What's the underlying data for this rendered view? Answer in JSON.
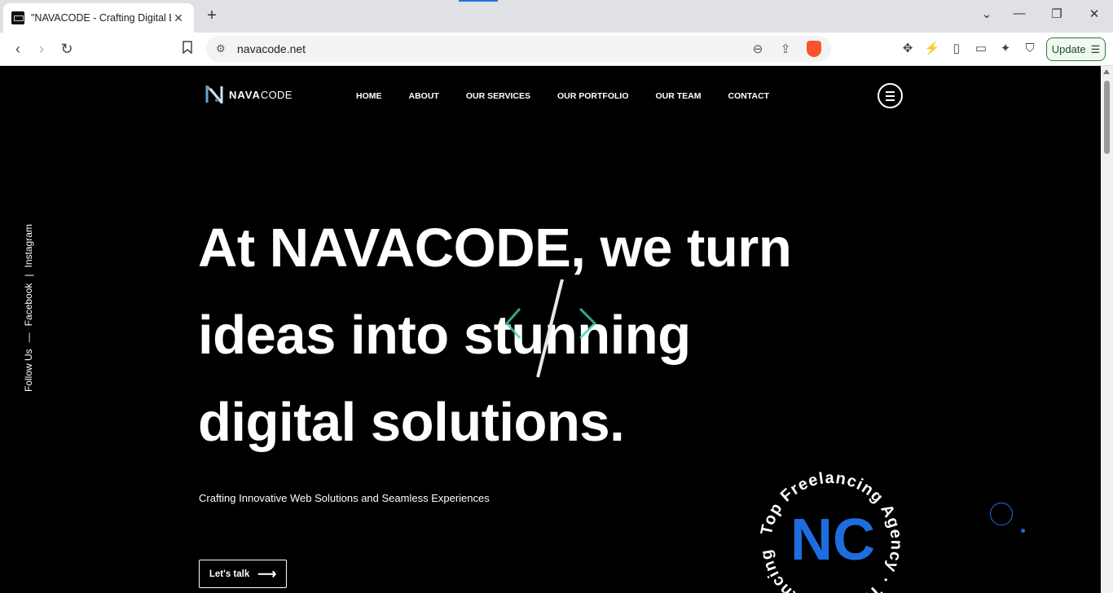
{
  "browser": {
    "tab_title": "\"NAVACODE - Crafting Digital E",
    "tab_close": "✕",
    "new_tab": "+",
    "url": "navacode.net",
    "update_label": "Update"
  },
  "site": {
    "logo_bold": "NAVA",
    "logo_light": "CODE",
    "nav": [
      "HOME",
      "ABOUT",
      "OUR SERVICES",
      "OUR PORTFOLIO",
      "OUR TEAM",
      "CONTACT"
    ],
    "social": {
      "follow_label": "Follow Us",
      "dash": "—",
      "facebook": "Facebook",
      "divider": "|",
      "instagram": "Instagram"
    },
    "headline": [
      "At NAVACODE, we turn",
      "ideas into stunning",
      "digital solutions."
    ],
    "subtitle": "Crafting Innovative Web Solutions and Seamless Experiences",
    "cta_label": "Let's talk",
    "cta_arrow": "⟶",
    "badge_ring_text": "Top Freelancing Agency · Top Freelancing Agency · ",
    "badge_initials": "NC"
  },
  "colors": {
    "accent_blue": "#1e6de0",
    "code_green": "#3fd1b5",
    "update_green": "#2f7d32"
  }
}
